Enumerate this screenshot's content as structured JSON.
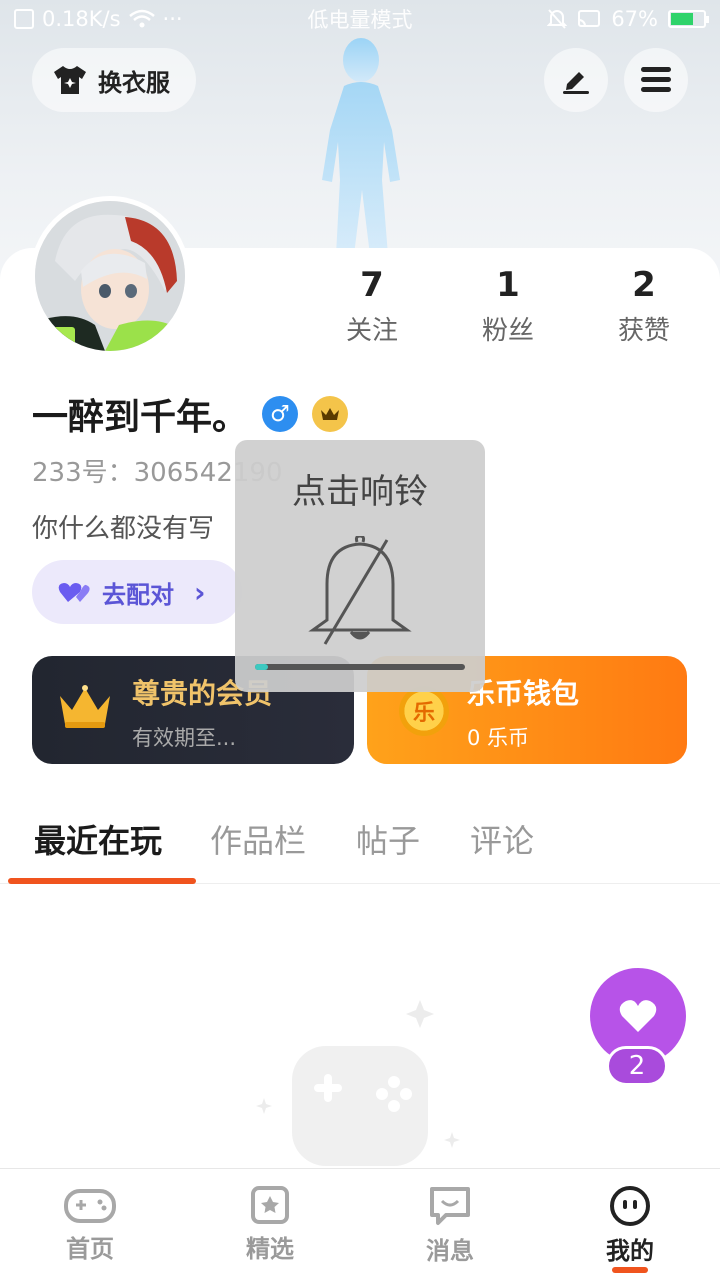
{
  "status_bar": {
    "net_speed": "0.18K/s",
    "more": "···",
    "mode": "低电量模式",
    "battery": "67%"
  },
  "header": {
    "outfit_label": "换衣服",
    "edit_icon": "pen-icon",
    "menu_icon": "hamburger-icon"
  },
  "profile": {
    "following_count": "7",
    "following_label": "关注",
    "fans_count": "1",
    "fans_label": "粉丝",
    "likes_count": "2",
    "likes_label": "获赞",
    "nickname": "一醉到千年。",
    "gender_symbol": "♂",
    "id_line": "233号：306542190",
    "bio": "你什么都没有写",
    "pair_label": "去配对",
    "pair_arrow": "›"
  },
  "cards": {
    "vip_title": "尊贵的会员",
    "vip_sub": "有效期至...",
    "wallet_title": "乐币钱包",
    "wallet_sub": "0 乐币",
    "wallet_coin": "乐"
  },
  "tabs": [
    {
      "label": "最近在玩"
    },
    {
      "label": "作品栏"
    },
    {
      "label": "帖子"
    },
    {
      "label": "评论"
    }
  ],
  "fab": {
    "count": "2"
  },
  "overlay": {
    "text": "点击响铃",
    "progress": 0.06
  },
  "bottom_nav": [
    {
      "label": "首页",
      "icon": "gamepad-icon"
    },
    {
      "label": "精选",
      "icon": "star-card-icon"
    },
    {
      "label": "消息",
      "icon": "chat-smile-icon"
    },
    {
      "label": "我的",
      "icon": "face-icon"
    }
  ],
  "colors": {
    "accent": "#f0541e",
    "vip_gold": "#f0c36a",
    "wallet_orange": "#ff8a14",
    "pair_purple": "#5b55d6",
    "fab_purple": "#b753e8"
  }
}
